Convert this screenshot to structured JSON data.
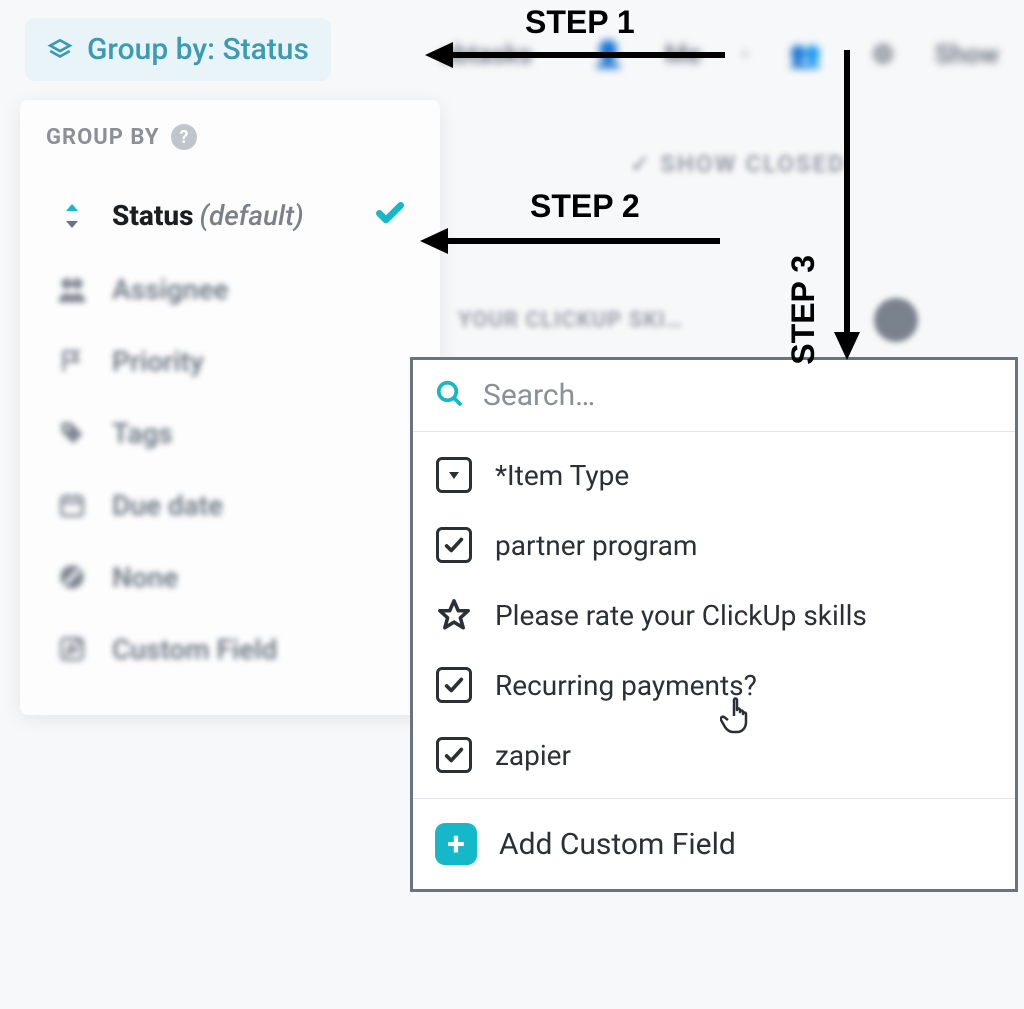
{
  "steps": {
    "step1": "STEP 1",
    "step2": "STEP 2",
    "step3": "STEP 3"
  },
  "top_pill": {
    "label": "Group by: Status"
  },
  "top_blurred": {
    "subtasks": "ubtasks",
    "me": "Me",
    "show": "Show"
  },
  "dropdown": {
    "header": "GROUP BY",
    "items": [
      {
        "label": "Status",
        "suffix": "(default)",
        "active": true
      },
      {
        "label": "Assignee"
      },
      {
        "label": "Priority"
      },
      {
        "label": "Tags"
      },
      {
        "label": "Due date"
      },
      {
        "label": "None"
      },
      {
        "label": "Custom Field"
      }
    ]
  },
  "show_closed": "SHOW CLOSED",
  "clickup_skill": "YOUR CLICKUP SKI…",
  "custom_field": {
    "search_placeholder": "Search…",
    "fields": [
      {
        "label": "*Item Type",
        "icon": "dropdown"
      },
      {
        "label": "partner program",
        "icon": "checkbox"
      },
      {
        "label": "Please rate your ClickUp skills",
        "icon": "star"
      },
      {
        "label": "Recurring payments?",
        "icon": "checkbox"
      },
      {
        "label": "zapier",
        "icon": "checkbox"
      }
    ],
    "add_label": "Add Custom Field"
  }
}
